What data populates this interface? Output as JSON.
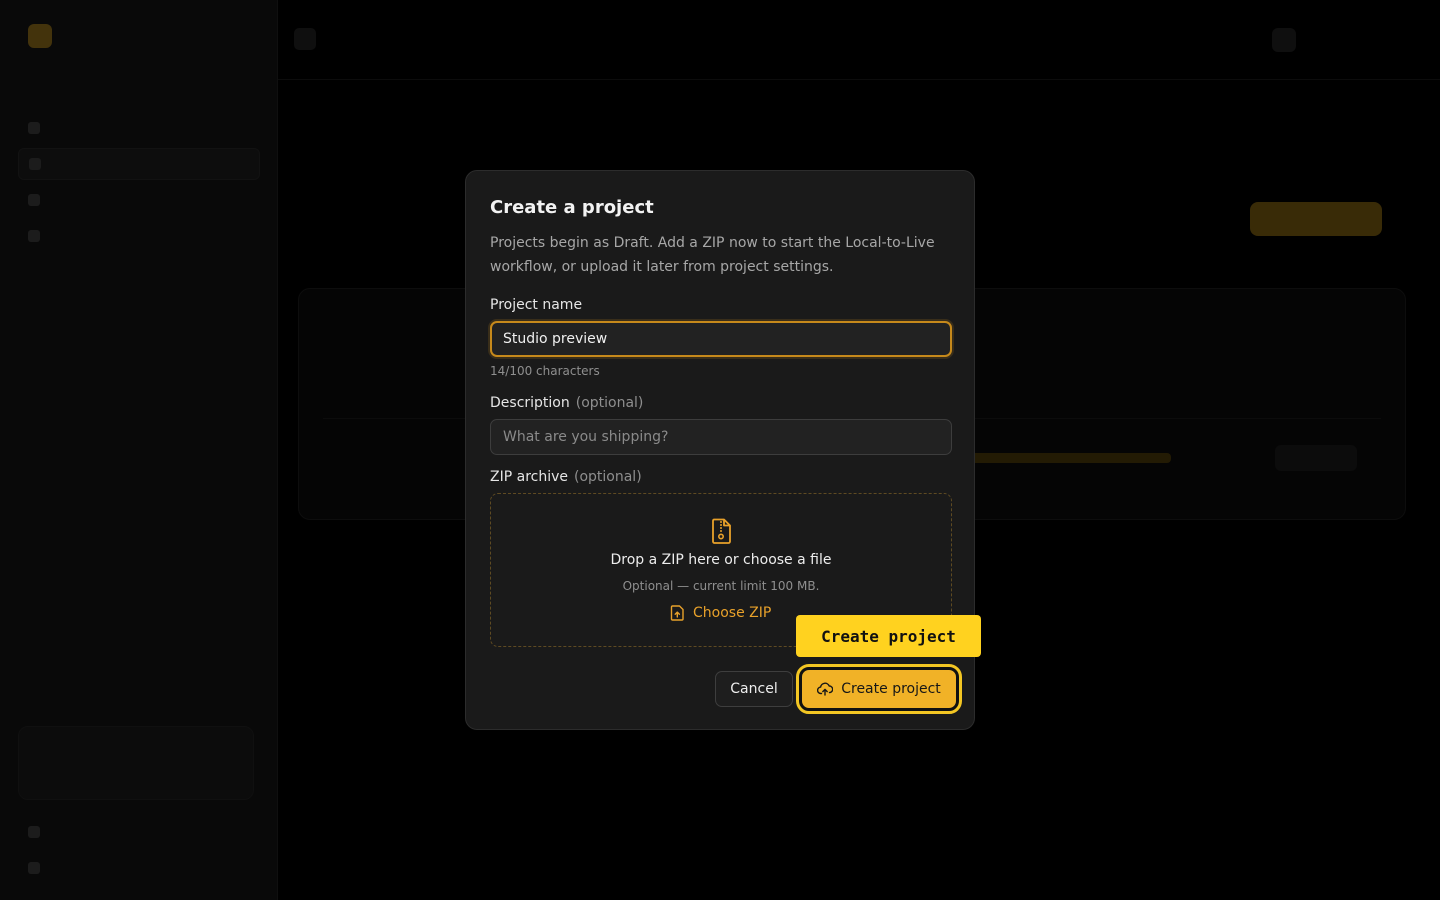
{
  "modal": {
    "title": "Create a project",
    "description": "Projects begin as Draft. Add a ZIP now to start the Local-to-Live workflow, or upload it later from project settings.",
    "name_field": {
      "label": "Project name",
      "value": "Studio preview",
      "char_count": "14/100 characters"
    },
    "description_field": {
      "label": "Description",
      "optional": "(optional)",
      "placeholder": "What are you shipping?"
    },
    "zip_field": {
      "label": "ZIP archive",
      "optional": "(optional)",
      "drop_title": "Drop a ZIP here or choose a file",
      "drop_note": "Optional — current limit 100 MB.",
      "choose_label": "Choose ZIP",
      "icon": "file-zip-icon"
    },
    "actions": {
      "cancel_label": "Cancel",
      "create_label": "Create project",
      "create_icon": "upload-cloud-icon"
    }
  },
  "tooltip": {
    "text": "Create project"
  },
  "colors": {
    "accent": "#f1b227",
    "tooltip_bg": "#ffd21f",
    "modal_bg": "#1a1a1a",
    "page_bg": "#000000"
  }
}
